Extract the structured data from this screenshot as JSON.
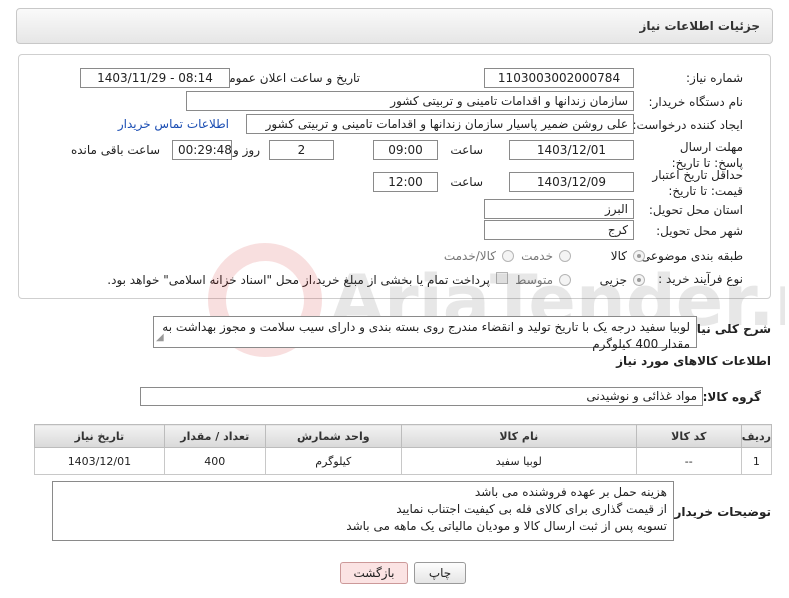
{
  "header": {
    "title": "جزئیات اطلاعات نیاز"
  },
  "form": {
    "need_number_label": "شماره نیاز:",
    "need_number": "1103003002000784",
    "announce_label": "تاریخ و ساعت اعلان عمومی:",
    "announce_value": "1403/11/29 - 08:14",
    "buyer_org_label": "نام دستگاه خریدار:",
    "buyer_org": "سازمان زندانها و اقدامات تامینی و تربیتی کشور",
    "creator_label": "ایجاد کننده درخواست:",
    "creator": "علی روشن ضمیر پاسیار سازمان زندانها و اقدامات تامینی و تربیتی کشور",
    "contact_link": "اطلاعات تماس خریدار",
    "deadline_label": "مهلت ارسال پاسخ: تا تاریخ:",
    "deadline_date": "1403/12/01",
    "time_label": "ساعت",
    "deadline_time": "09:00",
    "days_value": "2",
    "days_label": "روز و",
    "remaining_value": "00:29:48",
    "remaining_label": "ساعت باقی مانده",
    "validity_label": "حداقل تاریخ اعتبار قیمت: تا تاریخ:",
    "validity_date": "1403/12/09",
    "validity_time_label": "ساعت",
    "validity_time": "12:00",
    "province_label": "استان محل تحویل:",
    "province": "البرز",
    "city_label": "شهر محل تحویل:",
    "city": "کرج",
    "category_label": "طبقه بندی موضوعی:",
    "category_options": [
      "کالا",
      "خدمت",
      "کالا/خدمت"
    ],
    "process_label": "نوع فرآیند خرید :",
    "process_options": [
      "جزیی",
      "متوسط"
    ],
    "payment_note": "پرداخت تمام یا بخشی از مبلغ خرید،از محل \"اسناد خزانه اسلامی\" خواهد بود."
  },
  "description": {
    "label": "شرح کلی نیاز:",
    "text": "لوبیا سفید درجه یک با تاریخ تولید و انقضاء مندرج روی بسته بندی و دارای سیب سلامت و مجوز بهداشت به مقدار 400 کیلوگرم"
  },
  "goods": {
    "section_title": "اطلاعات کالاهای مورد نیاز",
    "group_label": "گروه کالا:",
    "group_value": "مواد غذائی و نوشیدنی",
    "columns": [
      "ردیف",
      "کد کالا",
      "نام کالا",
      "واحد شمارش",
      "تعداد / مقدار",
      "تاریخ نیاز"
    ],
    "rows": [
      [
        "1",
        "--",
        "لوبیا سفید",
        "کیلوگرم",
        "400",
        "1403/12/01"
      ]
    ]
  },
  "buyer_notes": {
    "label": "توضیحات خریدار:",
    "lines": [
      "هزینه حمل بر عهده فروشنده می باشد",
      "از قیمت گذاری برای کالای فله بی کیفیت اجتناب نمایید",
      "تسویه پس از ثبت ارسال کالا و مودیان مالیاتی یک ماهه می باشد"
    ]
  },
  "buttons": {
    "print": "چاپ",
    "back": "بازگشت"
  },
  "watermark": {
    "text": "AriaTender.net"
  }
}
